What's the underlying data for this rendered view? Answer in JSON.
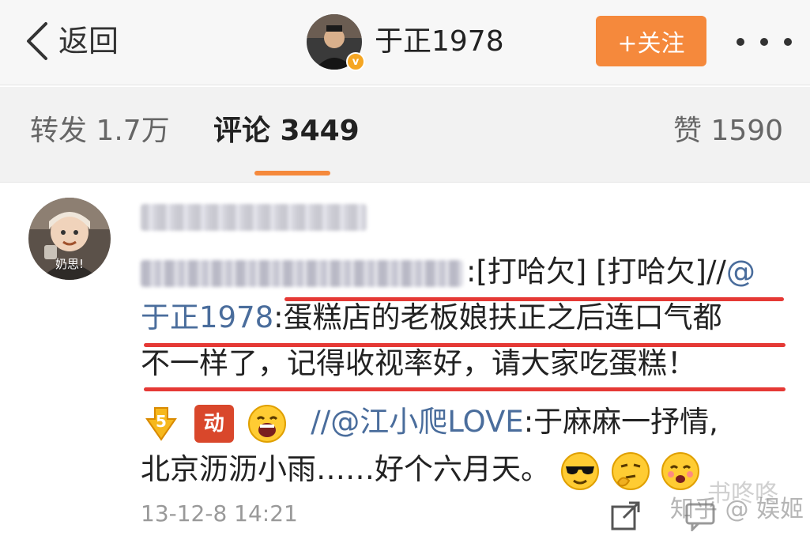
{
  "header": {
    "back_label": "返回",
    "username": "于正1978",
    "verified_badge": "v",
    "follow_label": "+关注"
  },
  "tabs": {
    "repost": "转发 1.7万",
    "comment": "评论 3449",
    "like": "赞 1590"
  },
  "comment": {
    "avatar_label": "奶思!",
    "line1_text": ":[打哈欠] [打哈欠]//",
    "line1_mention": "@",
    "line2_mention": "于正1978",
    "line2_text": ":蛋糕店的老板娘扶正之后连口气都",
    "line3_text": "不一样了，记得收视率好，请大家吃蛋糕！",
    "line4_badge": "动",
    "line4_mention": "//@江小爬LOVE",
    "line4_text": ":于麻麻一抒情,",
    "line5_text": "北京沥沥小雨……好个六月天。",
    "timestamp": "13-12-8 14:21"
  },
  "watermark": {
    "text": "知乎 @ 娱姬",
    "text2": "书咚咚"
  },
  "colors": {
    "accent": "#f5893c",
    "mention": "#4a6d9c",
    "highlight_underline": "#e53935"
  }
}
